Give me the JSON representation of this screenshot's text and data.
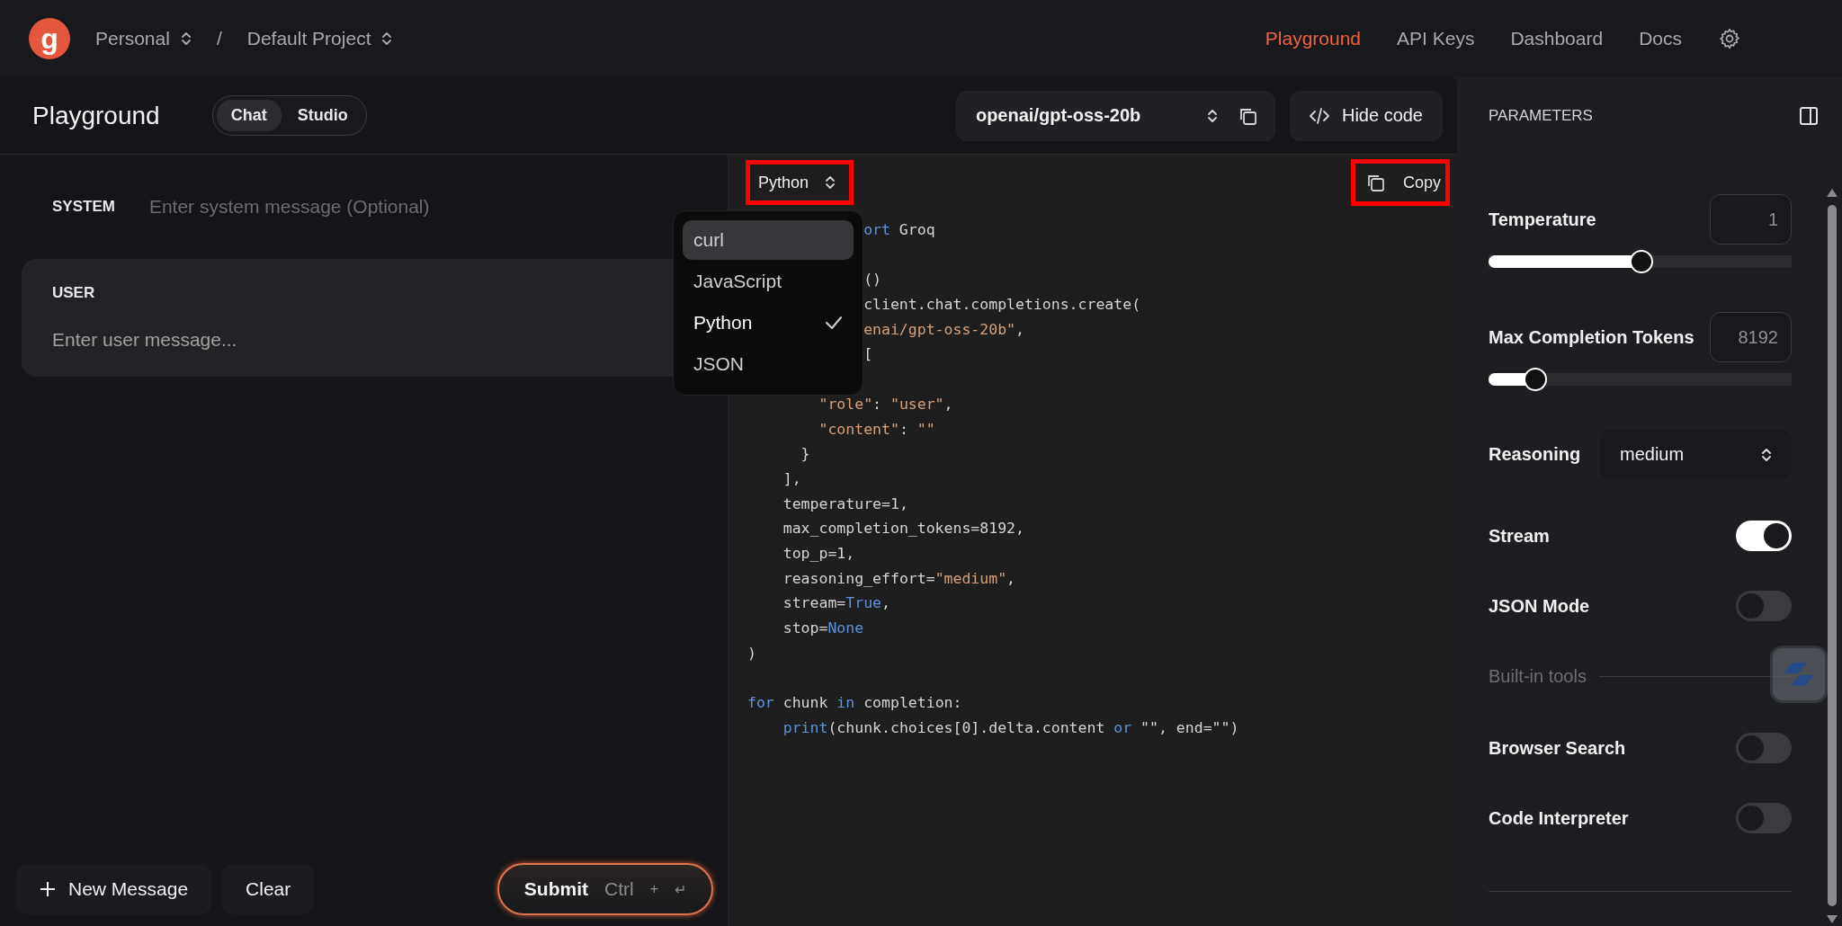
{
  "top_nav": {
    "logo": "g",
    "breadcrumbs": [
      {
        "label": "Personal"
      },
      {
        "label": "Default Project"
      }
    ],
    "separator": "/",
    "links": [
      {
        "label": "Playground",
        "selected": true
      },
      {
        "label": "API Keys",
        "selected": false
      },
      {
        "label": "Dashboard",
        "selected": false
      },
      {
        "label": "Docs",
        "selected": false
      }
    ]
  },
  "header": {
    "title": "Playground",
    "tabs": [
      {
        "label": "Chat",
        "selected": true
      },
      {
        "label": "Studio",
        "selected": false
      }
    ],
    "model": "openai/gpt-oss-20b",
    "hide_code": "Hide code"
  },
  "chat": {
    "system_label": "SYSTEM",
    "system_placeholder": "Enter system message (Optional)",
    "user_label": "USER",
    "user_placeholder": "Enter user message...",
    "new_message": "New Message",
    "clear": "Clear",
    "submit": "Submit",
    "shortcut": "Ctrl",
    "shortcut_plus": "+",
    "shortcut_key": "↵"
  },
  "code": {
    "language": "Python",
    "language_annotated": true,
    "copy": "Copy",
    "copy_annotated": true,
    "menu": [
      {
        "label": "curl",
        "highlighted": true,
        "selected": false
      },
      {
        "label": "JavaScript",
        "highlighted": false,
        "selected": false
      },
      {
        "label": "Python",
        "highlighted": false,
        "selected": true
      },
      {
        "label": "JSON",
        "highlighted": false,
        "selected": false
      }
    ],
    "lines": [
      {
        "covered": true,
        "tokens": [
          {
            "text": "ort",
            "kind": "keyword"
          },
          {
            "text": " Groq",
            "kind": "plain"
          }
        ]
      },
      {
        "kind": "blank"
      },
      {
        "covered": true,
        "tokens": [
          {
            "text": "()",
            "kind": "plain"
          }
        ]
      },
      {
        "covered": true,
        "tokens": [
          {
            "text": "client.chat.completions.create(",
            "kind": "plain"
          }
        ]
      },
      {
        "covered": true,
        "tokens": [
          {
            "text": "enai/gpt-oss-20b\"",
            "kind": "string"
          },
          {
            "text": ",",
            "kind": "plain"
          }
        ]
      },
      {
        "covered": true,
        "tokens": [
          {
            "text": "[",
            "kind": "plain"
          }
        ]
      },
      {
        "kind": "blank"
      },
      {
        "tokens": [
          {
            "text": "        \"role\"",
            "kind": "string"
          },
          {
            "text": ": ",
            "kind": "plain"
          },
          {
            "text": "\"user\"",
            "kind": "string"
          },
          {
            "text": ",",
            "kind": "plain"
          }
        ]
      },
      {
        "tokens": [
          {
            "text": "        \"content\"",
            "kind": "string"
          },
          {
            "text": ": ",
            "kind": "plain"
          },
          {
            "text": "\"\"",
            "kind": "string"
          }
        ]
      },
      {
        "tokens": [
          {
            "text": "      }",
            "kind": "plain"
          }
        ]
      },
      {
        "tokens": [
          {
            "text": "    ],",
            "kind": "plain"
          }
        ]
      },
      {
        "tokens": [
          {
            "text": "    temperature=1,",
            "kind": "plain"
          }
        ]
      },
      {
        "tokens": [
          {
            "text": "    max_completion_tokens=8192,",
            "kind": "plain"
          }
        ]
      },
      {
        "tokens": [
          {
            "text": "    top_p=1,",
            "kind": "plain"
          }
        ]
      },
      {
        "tokens": [
          {
            "text": "    reasoning_effort=",
            "kind": "plain"
          },
          {
            "text": "\"medium\"",
            "kind": "string"
          },
          {
            "text": ",",
            "kind": "plain"
          }
        ]
      },
      {
        "tokens": [
          {
            "text": "    stream=",
            "kind": "plain"
          },
          {
            "text": "True",
            "kind": "keyword"
          },
          {
            "text": ",",
            "kind": "plain"
          }
        ]
      },
      {
        "tokens": [
          {
            "text": "    stop=",
            "kind": "plain"
          },
          {
            "text": "None",
            "kind": "keyword"
          }
        ]
      },
      {
        "tokens": [
          {
            "text": ")",
            "kind": "plain"
          }
        ]
      },
      {
        "kind": "blank"
      },
      {
        "tokens": [
          {
            "text": "for",
            "kind": "keyword"
          },
          {
            "text": " chunk ",
            "kind": "plain"
          },
          {
            "text": "in",
            "kind": "keyword"
          },
          {
            "text": " completion:",
            "kind": "plain"
          }
        ]
      },
      {
        "tokens": [
          {
            "text": "    print",
            "kind": "keyword"
          },
          {
            "text": "(chunk.choices[0].delta.content ",
            "kind": "plain"
          },
          {
            "text": "or",
            "kind": "keyword"
          },
          {
            "text": " \"\", end=\"\")",
            "kind": "plain"
          }
        ]
      }
    ]
  },
  "parameters": {
    "title": "PARAMETERS",
    "rows": [
      {
        "kind": "slider",
        "label": "Temperature",
        "value": "1",
        "level": 0.5
      },
      {
        "kind": "slider",
        "label": "Max Completion Tokens",
        "value": "8192",
        "level": 0.15
      },
      {
        "kind": "select",
        "label": "Reasoning",
        "value": "medium"
      },
      {
        "kind": "toggle",
        "label": "Stream",
        "on": true
      },
      {
        "kind": "toggle",
        "label": "JSON Mode",
        "on": false
      },
      {
        "kind": "section",
        "label": "Built-in tools"
      },
      {
        "kind": "toggle",
        "label": "Browser Search",
        "on": false
      },
      {
        "kind": "toggle",
        "label": "Code Interpreter",
        "on": false
      }
    ]
  }
}
